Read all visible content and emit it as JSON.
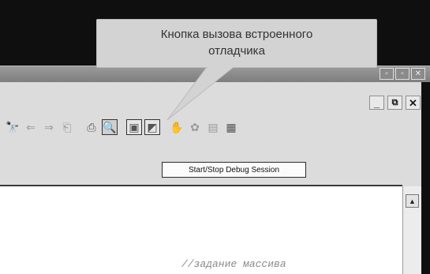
{
  "callout": {
    "line1": "Кнопка вызова встроенного",
    "line2": "отладчика"
  },
  "tooltip": {
    "text": "Start/Stop Debug Session"
  },
  "window_buttons": {
    "minimize": "_",
    "restore": "🗗",
    "close": "✕"
  },
  "title_buttons": [
    "▫",
    "▫",
    "✕"
  ],
  "toolbar_icons": [
    "binoculars-icon",
    "back-arrow-icon",
    "forward-arrow-icon",
    "bookmark-icon",
    "print-icon",
    "debug-icon",
    "window-icon",
    "window-select-icon",
    "hand-icon",
    "breakpoint-icon",
    "disabled-icon",
    "settings-icon"
  ],
  "editor": {
    "code_line": "//задание массива"
  }
}
